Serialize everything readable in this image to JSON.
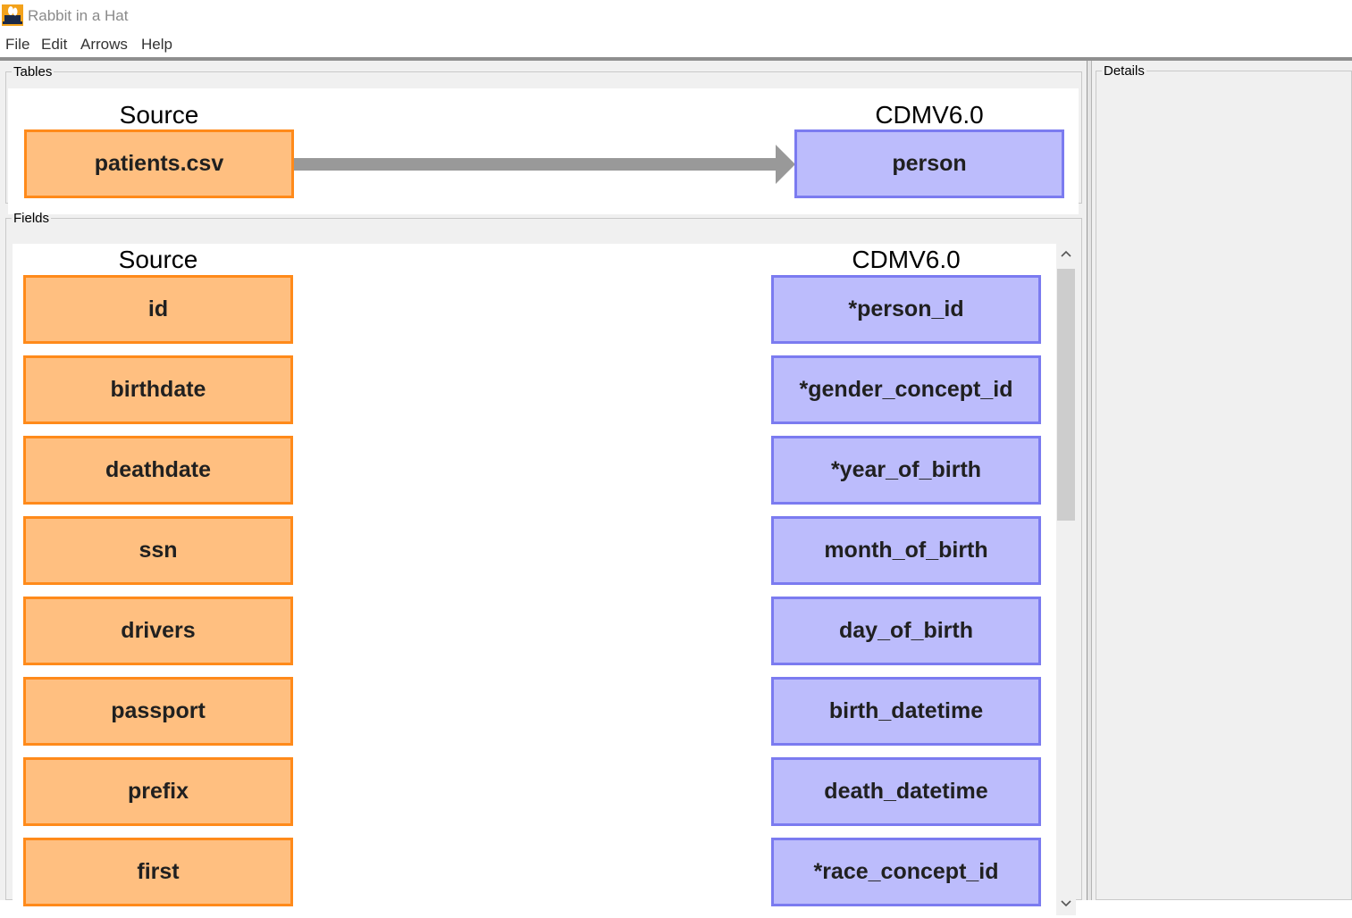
{
  "window": {
    "title": "Rabbit in a Hat",
    "icon": "rabbit-hat-icon"
  },
  "menu": [
    "File",
    "Edit",
    "Arrows",
    "Help"
  ],
  "tables_panel": {
    "legend": "Tables",
    "source_header": "Source",
    "target_header": "CDMV6.0",
    "source_table": "patients.csv",
    "target_table": "person"
  },
  "fields_panel": {
    "legend": "Fields",
    "source_header": "Source",
    "target_header": "CDMV6.0",
    "source_fields": [
      "id",
      "birthdate",
      "deathdate",
      "ssn",
      "drivers",
      "passport",
      "prefix",
      "first"
    ],
    "target_fields": [
      "*person_id",
      "*gender_concept_id",
      "*year_of_birth",
      "month_of_birth",
      "day_of_birth",
      "birth_datetime",
      "death_datetime",
      "*race_concept_id"
    ]
  },
  "details_panel": {
    "legend": "Details"
  },
  "colors": {
    "source_fill": "#ffbf80",
    "source_border": "#ff8a1a",
    "target_fill": "#bcbcfc",
    "target_border": "#7b7bf0",
    "arrow": "#999999"
  }
}
